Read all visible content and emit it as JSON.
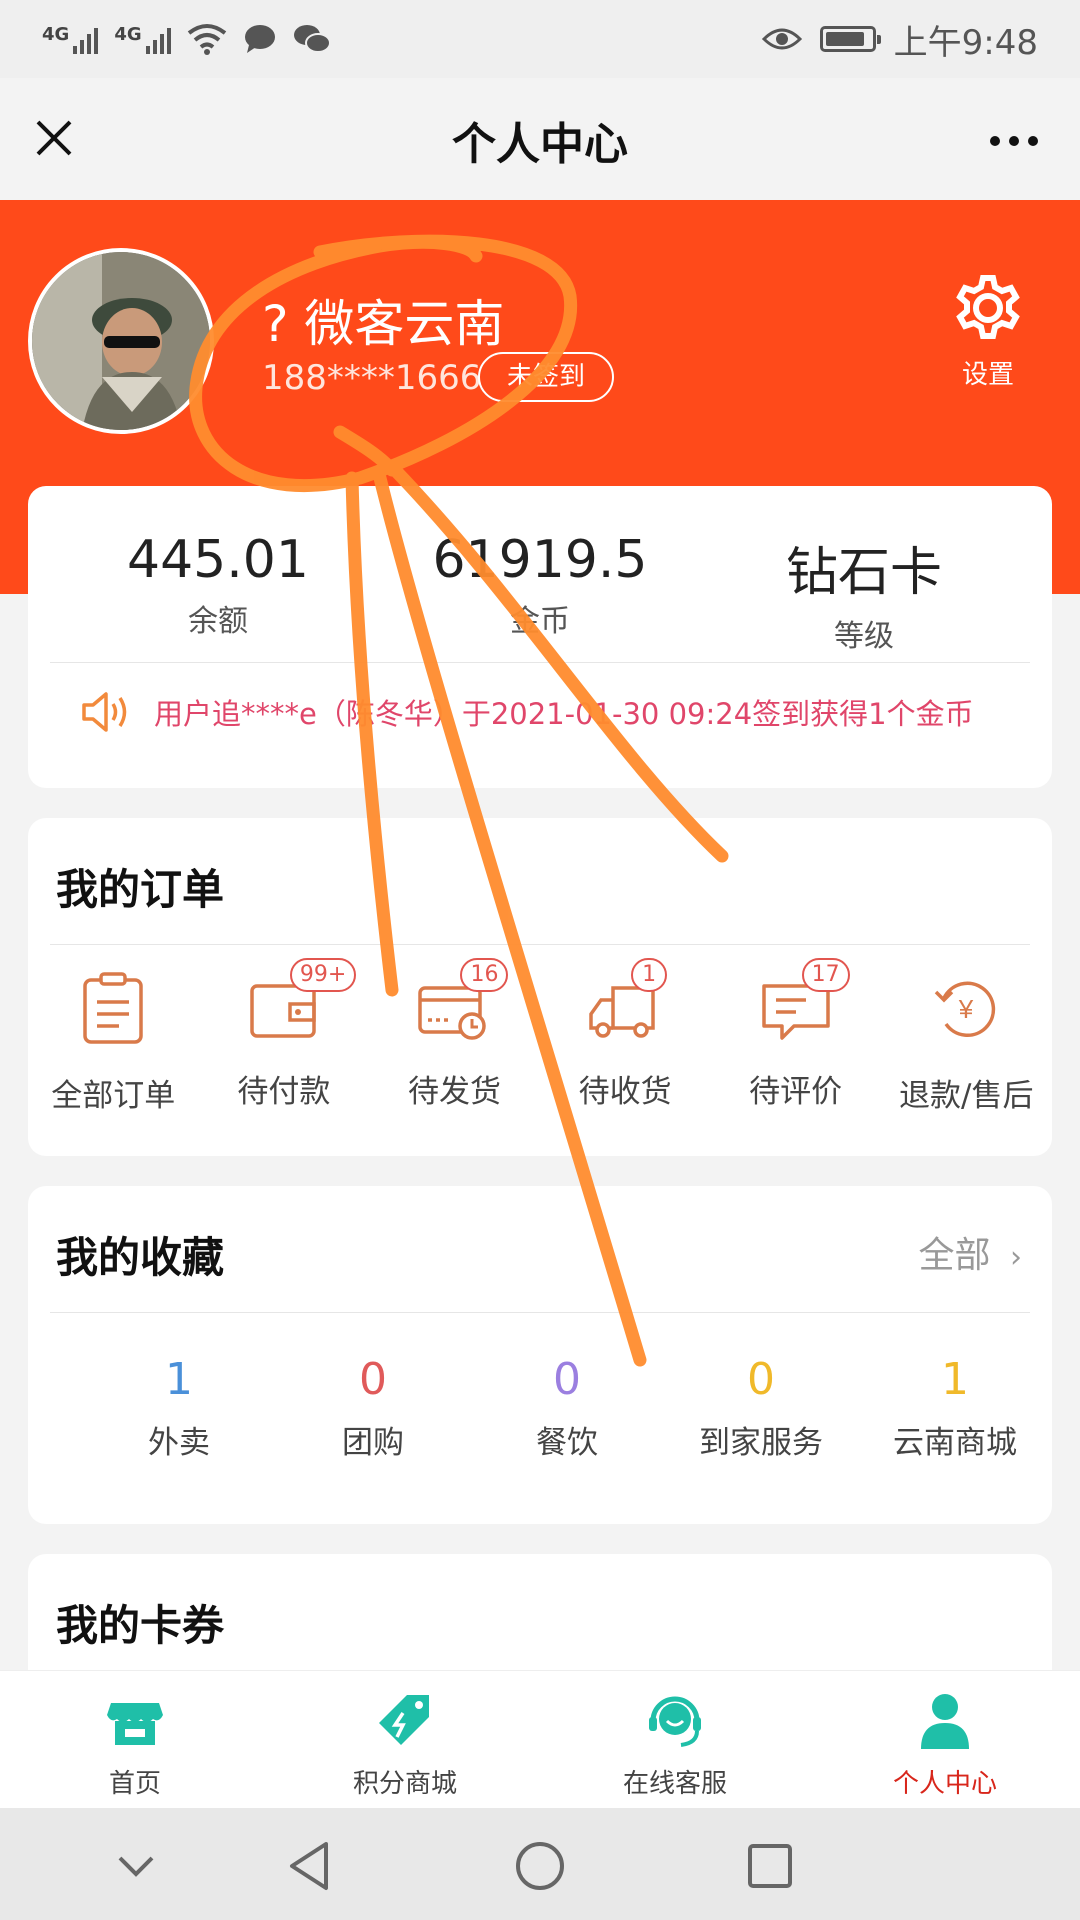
{
  "status_bar": {
    "network_1": "4G",
    "network_2": "4G",
    "time": "上午9:48"
  },
  "header": {
    "title": "个人中心"
  },
  "profile": {
    "name": "? 微客云南",
    "phone": "188****1666",
    "signin_label": "未签到",
    "settings_label": "设置"
  },
  "stats": [
    {
      "value": "445.01",
      "label": "余额"
    },
    {
      "value": "61919.5",
      "label": "金币"
    },
    {
      "value": "钻石卡",
      "label": "等级"
    }
  ],
  "notice": "用户追****e（陈冬华）于2021-01-30 09:24签到获得1个金币",
  "orders": {
    "title": "我的订单",
    "items": [
      {
        "label": "全部订单",
        "badge": ""
      },
      {
        "label": "待付款",
        "badge": "99+"
      },
      {
        "label": "待发货",
        "badge": "16"
      },
      {
        "label": "待收货",
        "badge": "1"
      },
      {
        "label": "待评价",
        "badge": "17"
      },
      {
        "label": "退款/售后",
        "badge": ""
      }
    ]
  },
  "favorites": {
    "title": "我的收藏",
    "all_label": "全部",
    "items": [
      {
        "count": "1",
        "label": "外卖",
        "color": "#4a90d9"
      },
      {
        "count": "0",
        "label": "团购",
        "color": "#e05a5a"
      },
      {
        "count": "0",
        "label": "餐饮",
        "color": "#9b7fe0"
      },
      {
        "count": "0",
        "label": "到家服务",
        "color": "#f0b92a"
      },
      {
        "count": "1",
        "label": "云南商城",
        "color": "#f0b92a"
      }
    ]
  },
  "coupons": {
    "title": "我的卡券"
  },
  "tabs": [
    {
      "label": "首页",
      "active": false
    },
    {
      "label": "积分商城",
      "active": false
    },
    {
      "label": "在线客服",
      "active": false
    },
    {
      "label": "个人中心",
      "active": true
    }
  ],
  "colors": {
    "brand": "#ff4a1a",
    "tab_icon": "#1fbfa8",
    "active_tab": "#d8261b",
    "annotation": "#ff8c2e"
  }
}
